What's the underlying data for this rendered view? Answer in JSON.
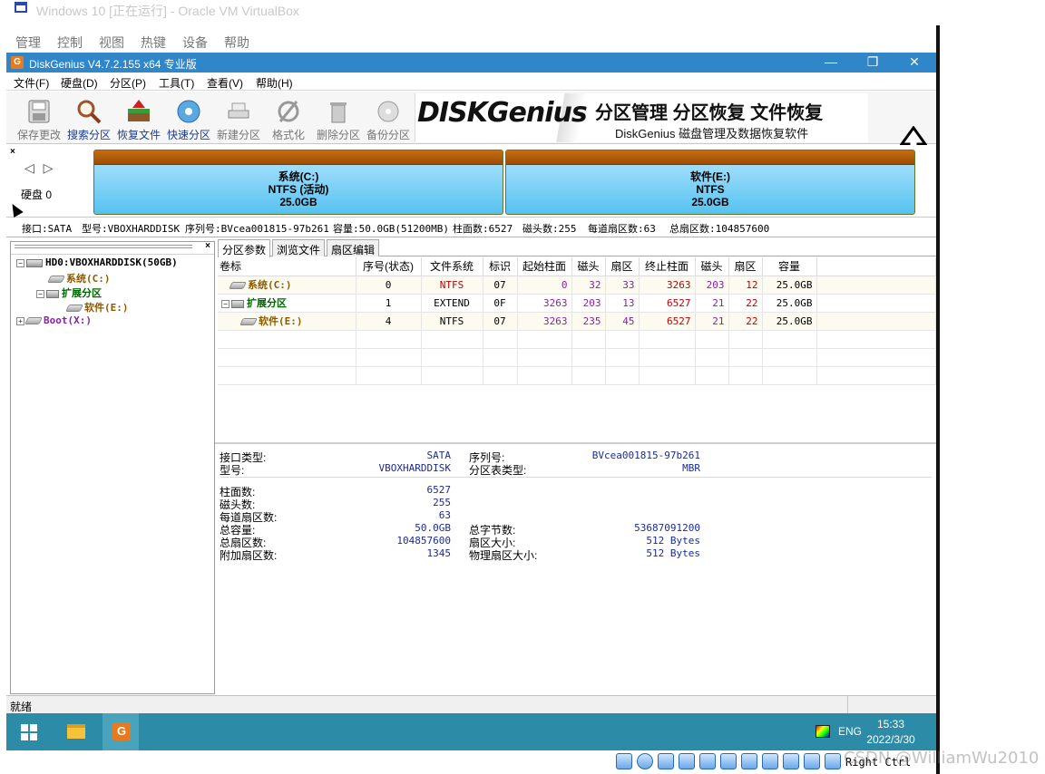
{
  "vbox": {
    "window_title": "Windows 10 [正在运行] - Oracle VM VirtualBox",
    "menu": [
      "管理",
      "控制",
      "视图",
      "热键",
      "设备",
      "帮助"
    ],
    "host_key": "Right Ctrl"
  },
  "app": {
    "title": "DiskGenius V4.7.2.155 x64 专业版",
    "minimize": "—",
    "restore": "❐",
    "close": "✕",
    "menu": [
      "文件(F)",
      "硬盘(D)",
      "分区(P)",
      "工具(T)",
      "查看(V)",
      "帮助(H)"
    ]
  },
  "toolbar": {
    "buttons": [
      {
        "label": "保存更改",
        "icon": "save-icon",
        "enabled": false
      },
      {
        "label": "搜索分区",
        "icon": "search-partition-icon",
        "enabled": true
      },
      {
        "label": "恢复文件",
        "icon": "recover-files-icon",
        "enabled": true
      },
      {
        "label": "快速分区",
        "icon": "quick-partition-icon",
        "enabled": true
      },
      {
        "label": "新建分区",
        "icon": "new-partition-icon",
        "enabled": false
      },
      {
        "label": "格式化",
        "icon": "format-icon",
        "enabled": false
      },
      {
        "label": "删除分区",
        "icon": "delete-partition-icon",
        "enabled": false
      },
      {
        "label": "备份分区",
        "icon": "backup-partition-icon",
        "enabled": false
      }
    ],
    "banner_logo": "DISKGenius",
    "banner_slogan": "分区管理 分区恢复 文件恢复",
    "banner_sub": "DiskGenius 磁盘管理及数据恢复软件"
  },
  "diskbar": {
    "close": "×",
    "nav": "◁ ▷",
    "disk_label": "硬盘 0",
    "partitions": [
      {
        "name": "系统(C:)",
        "fs": "NTFS (活动)",
        "size": "25.0GB"
      },
      {
        "name": "软件(E:)",
        "fs": "NTFS",
        "size": "25.0GB"
      }
    ]
  },
  "diskinfo": {
    "interface": "接口:SATA",
    "model": "型号:VBOXHARDDISK",
    "serial": "序列号:BVcea001815-97b261",
    "capacity": "容量:50.0GB(51200MB)",
    "cylinders": "柱面数:6527",
    "heads": "磁头数:255",
    "sectors_per_track": "每道扇区数:63",
    "total_sectors": "总扇区数:104857600"
  },
  "tree": {
    "close": "×",
    "items": [
      {
        "label": "HD0:VBOXHARDDISK(50GB)",
        "expander": "−"
      },
      {
        "label": "系统(C:)"
      },
      {
        "label": "扩展分区",
        "expander": "−"
      },
      {
        "label": "软件(E:)"
      },
      {
        "label": "Boot(X:)",
        "expander": "+"
      }
    ]
  },
  "tabs": [
    "分区参数",
    "浏览文件",
    "扇区编辑"
  ],
  "partition_table": {
    "headers": [
      "卷标",
      "序号(状态)",
      "文件系统",
      "标识",
      "起始柱面",
      "磁头",
      "扇区",
      "终止柱面",
      "磁头",
      "扇区",
      "容量"
    ],
    "rows": [
      {
        "label": "系统(C:)",
        "index": "0",
        "fs": "NTFS",
        "id": "07",
        "start_cyl": "0",
        "start_head": "32",
        "start_sec": "33",
        "end_cyl": "3263",
        "end_head": "203",
        "end_sec": "12",
        "size": "25.0GB"
      },
      {
        "label": "扩展分区",
        "index": "1",
        "fs": "EXTEND",
        "id": "0F",
        "start_cyl": "3263",
        "start_head": "203",
        "start_sec": "13",
        "end_cyl": "6527",
        "end_head": "21",
        "end_sec": "22",
        "size": "25.0GB"
      },
      {
        "label": "软件(E:)",
        "index": "4",
        "fs": "NTFS",
        "id": "07",
        "start_cyl": "3263",
        "start_head": "235",
        "start_sec": "45",
        "end_cyl": "6527",
        "end_head": "21",
        "end_sec": "22",
        "size": "25.0GB"
      }
    ]
  },
  "details": {
    "interface_type_label": "接口类型:",
    "interface_type": "SATA",
    "serial_label": "序列号:",
    "serial": "BVcea001815-97b261",
    "model_label": "型号:",
    "model": "VBOXHARDDISK",
    "ptable_type_label": "分区表类型:",
    "ptable_type": "MBR",
    "cylinders_label": "柱面数:",
    "cylinders": "6527",
    "heads_label": "磁头数:",
    "heads": "255",
    "spt_label": "每道扇区数:",
    "spt": "63",
    "capacity_label": "总容量:",
    "capacity": "50.0GB",
    "total_bytes_label": "总字节数:",
    "total_bytes": "53687091200",
    "total_sectors_label": "总扇区数:",
    "total_sectors": "104857600",
    "sector_size_label": "扇区大小:",
    "sector_size": "512 Bytes",
    "extra_sectors_label": "附加扇区数:",
    "extra_sectors": "1345",
    "phys_sector_size_label": "物理扇区大小:",
    "phys_sector_size": "512 Bytes"
  },
  "status": {
    "text": "就绪"
  },
  "taskbar": {
    "lang": "ENG",
    "time": "15:33",
    "date": "2022/3/30"
  },
  "watermark": "CSDN @WilliamWu2010",
  "colors": {
    "title_bar": "#2f86c9",
    "taskbar": "#2c8ba6",
    "partition_fill": "#56c2f0",
    "partition_top": "#b06008"
  }
}
